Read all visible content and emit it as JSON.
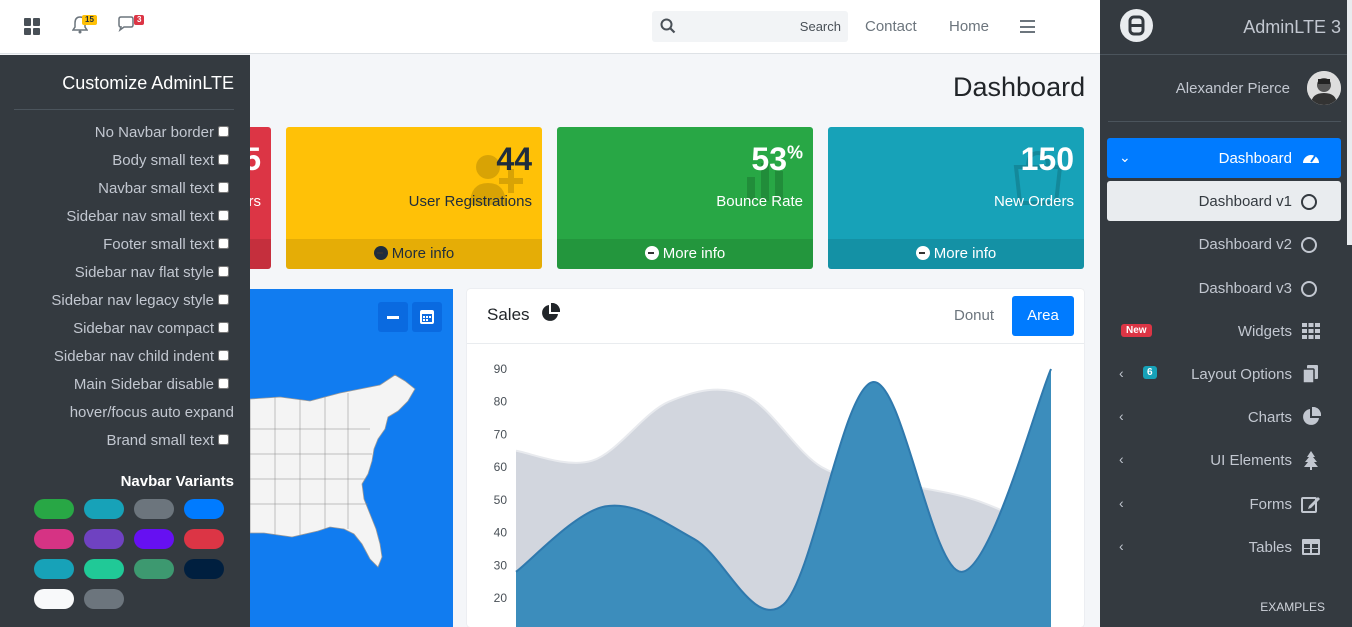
{
  "navbar": {
    "notifications_count": "15",
    "messages_count": "3",
    "search_placeholder": "Search",
    "links": [
      "Contact",
      "Home"
    ]
  },
  "page": {
    "title": "Dashboard"
  },
  "small_boxes": [
    {
      "value": "5",
      "label": "rs",
      "footer": "More info",
      "color": "#dc3545"
    },
    {
      "value": "44",
      "label": "User Registrations",
      "footer": "More info",
      "color": "#ffc107"
    },
    {
      "value": "53",
      "suffix": "%",
      "label": "Bounce Rate",
      "footer": "More info",
      "color": "#28a745"
    },
    {
      "value": "150",
      "label": "New Orders",
      "footer": "More info",
      "color": "#17a2b8"
    }
  ],
  "sales": {
    "title": "Sales",
    "tabs": [
      "Donut",
      "Area"
    ],
    "active_tab": "Area"
  },
  "chart_data": {
    "type": "area",
    "y_ticks": [
      "90",
      "80",
      "70",
      "60",
      "50",
      "40",
      "30",
      "20"
    ],
    "ylim": [
      15,
      95
    ],
    "series": [
      {
        "values": [
          65,
          62,
          80,
          82,
          60,
          55,
          50,
          40
        ],
        "color": "#d2d6de"
      },
      {
        "values": [
          28,
          48,
          38,
          18,
          86,
          28,
          90
        ],
        "color": "#3c8dbc"
      }
    ]
  },
  "customize": {
    "title": "Customize AdminLTE",
    "options": [
      "No Navbar border",
      "Body small text",
      "Navbar small text",
      "Sidebar nav small text",
      "Footer small text",
      "Sidebar nav flat style",
      "Sidebar nav legacy style",
      "Sidebar nav compact",
      "Sidebar nav child indent",
      "Main Sidebar disable",
      "hover/focus auto expand",
      "Brand small text"
    ],
    "variants_title": "Navbar Variants",
    "swatches": [
      "#28a745",
      "#17a2b8",
      "#6c757d",
      "#007bff",
      "#d63384",
      "#6f42c1",
      "#6610f2",
      "#dc3545",
      "#17a2b8",
      "#20c997",
      "#3d9970",
      "#001f3f",
      "#f8f9fa",
      "#6c757d",
      "#343a40",
      "#343a40"
    ]
  },
  "sidebar": {
    "brand": "AdminLTE 3",
    "user": "Alexander Pierce",
    "items": [
      {
        "label": "Dashboard"
      },
      {
        "label": "Dashboard v1"
      },
      {
        "label": "Dashboard v2"
      },
      {
        "label": "Dashboard v3"
      },
      {
        "label": "Widgets",
        "badge": "New"
      },
      {
        "label": "Layout Options",
        "badge": "6"
      },
      {
        "label": "Charts"
      },
      {
        "label": "UI Elements"
      },
      {
        "label": "Forms"
      },
      {
        "label": "Tables"
      }
    ],
    "section_header": "EXAMPLES"
  }
}
